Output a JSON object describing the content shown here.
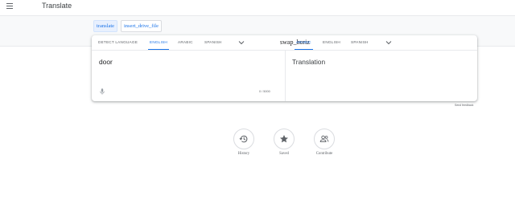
{
  "app": {
    "title": "Translate"
  },
  "modes": [
    {
      "label": "translate"
    },
    {
      "label": "insert_drive_file"
    }
  ],
  "source": {
    "languages": [
      "DETECT LANGUAGE",
      "ENGLISH",
      "ARABIC",
      "SPANISH"
    ],
    "active": "ENGLISH",
    "text": "door",
    "counter": "0 / 5000"
  },
  "swap_label": "swap_horiz",
  "target": {
    "languages": [
      "ARABIC",
      "ENGLISH",
      "SPANISH"
    ],
    "active": "ARABIC",
    "text": "Translation"
  },
  "feedback": "Send feedback",
  "actions": [
    {
      "label": "History",
      "icon": "history-icon"
    },
    {
      "label": "Saved",
      "icon": "star-icon"
    },
    {
      "label": "Contribute",
      "icon": "people-icon"
    }
  ],
  "colors": {
    "accent": "#1a73e8",
    "text": "#202124",
    "muted": "#5f6368",
    "band": "#f8f9fa"
  }
}
